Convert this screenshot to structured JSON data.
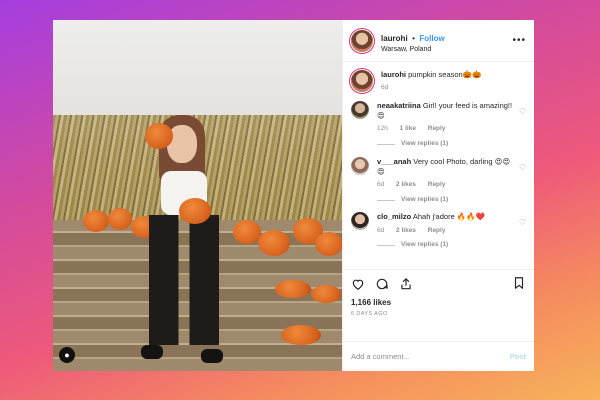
{
  "post": {
    "username": "laurohi",
    "separator": "•",
    "follow_label": "Follow",
    "location": "Warsaw, Poland",
    "more_icon": "more-horizontal-icon"
  },
  "caption": {
    "username": "laurohi",
    "text": "pumpkin season🎃🎃",
    "age": "6d"
  },
  "comments": [
    {
      "username": "neaakatriina",
      "text": "Girl! your feed is amazing!!😍",
      "age": "12h",
      "likes": "1 like",
      "reply": "Reply",
      "view_replies": "View replies (1)"
    },
    {
      "username": "v___anah",
      "text": "Very cool Photo, darling 😍😍😍",
      "age": "6d",
      "likes": "2 likes",
      "reply": "Reply",
      "view_replies": "View replies (1)"
    },
    {
      "username": "clo_milzo",
      "text": "Ahah j'adore 🔥🔥❤️",
      "age": "6d",
      "likes": "2 likes",
      "reply": "Reply",
      "view_replies": "View replies (1)"
    }
  ],
  "actions": {
    "like_icon": "heart-icon",
    "comment_icon": "comment-icon",
    "share_icon": "share-icon",
    "save_icon": "bookmark-icon"
  },
  "likes_text": "1,166 likes",
  "timestamp": "6 DAYS AGO",
  "add_comment": {
    "placeholder": "Add a comment...",
    "post_label": "Post"
  },
  "colors": {
    "link": "#3897f0",
    "muted": "#8e8e8e",
    "text": "#262626"
  }
}
